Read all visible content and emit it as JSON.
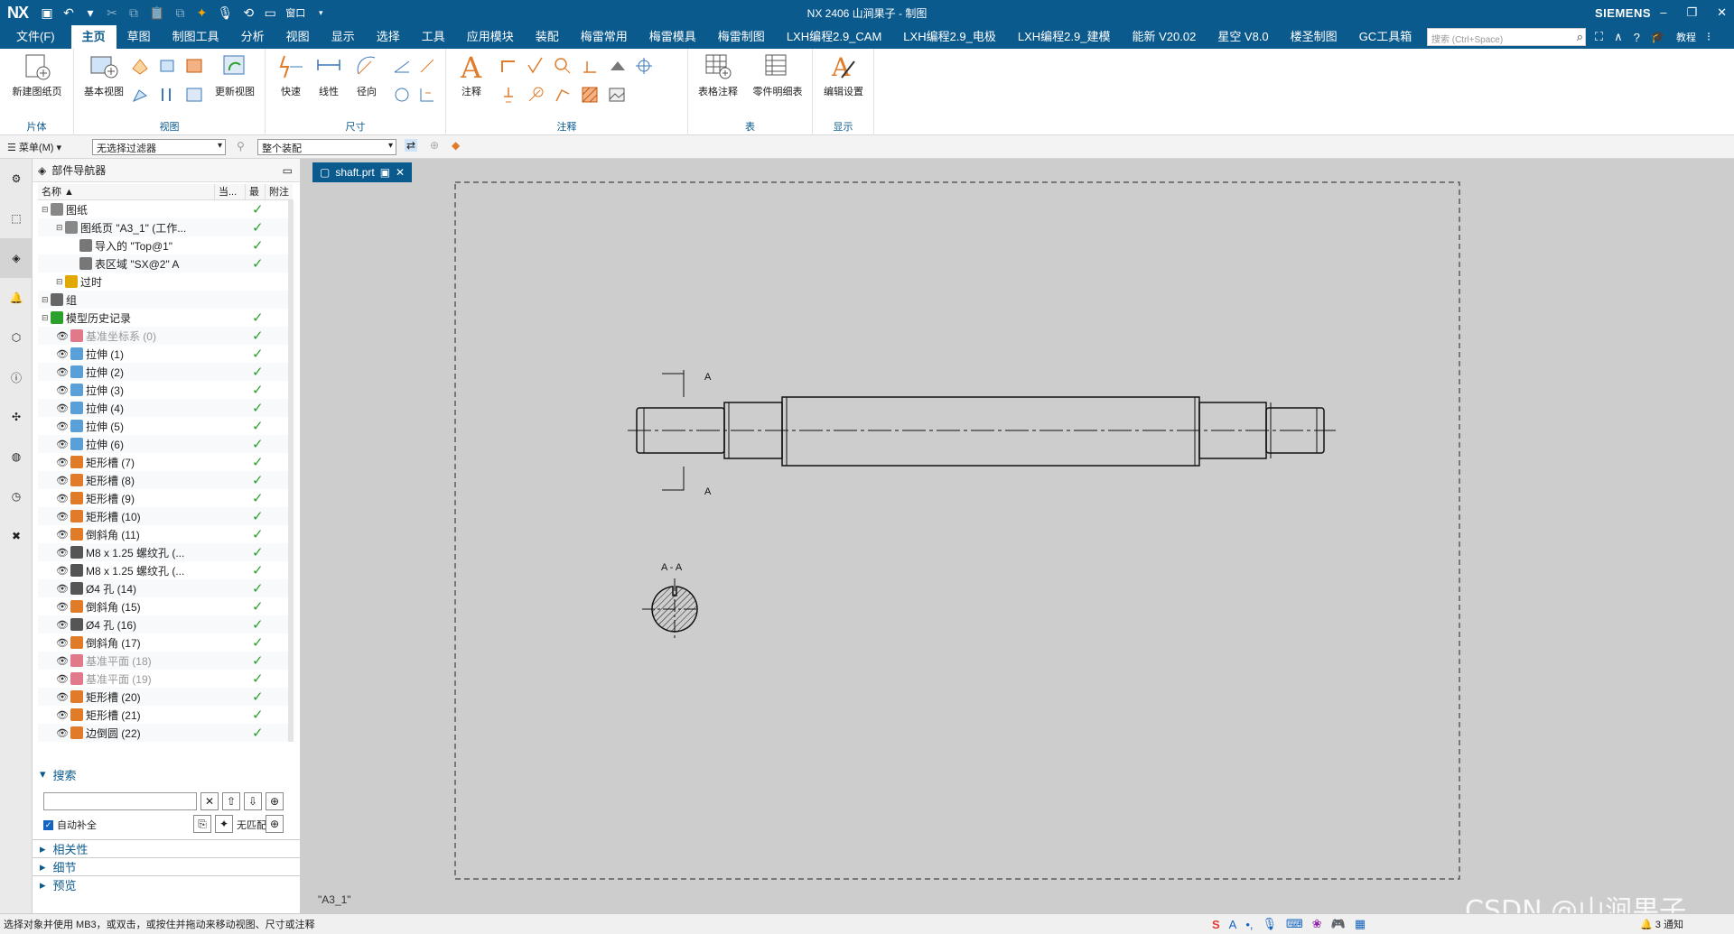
{
  "app": {
    "logo": "NX",
    "window_title": "NX 2406 山涧果子 - 制图",
    "brand": "SIEMENS",
    "window_menu": "窗口",
    "search_placeholder": "搜索 (Ctrl+Space)",
    "tutorial": "教程"
  },
  "menu": {
    "tabs": [
      "文件(F)",
      "主页",
      "草图",
      "制图工具",
      "分析",
      "视图",
      "显示",
      "选择",
      "工具",
      "应用模块",
      "装配",
      "梅雷常用",
      "梅雷模具",
      "梅雷制图",
      "LXH编程2.9_CAM",
      "LXH编程2.9_电极",
      "LXH编程2.9_建模",
      "能新 V20.02",
      "星空 V8.0",
      "楼圣制图",
      "GC工具箱"
    ],
    "active_index": 1
  },
  "ribbon": {
    "groups": [
      {
        "title": "片体",
        "buttons": [
          "新建图纸页"
        ]
      },
      {
        "title": "视图",
        "buttons": [
          "基本视图",
          "更新视图"
        ]
      },
      {
        "title": "尺寸",
        "buttons": [
          "快速",
          "线性",
          "径向"
        ]
      },
      {
        "title": "注释",
        "buttons": [
          "注释"
        ]
      },
      {
        "title": "表",
        "buttons": [
          "表格注释",
          "零件明细表"
        ]
      },
      {
        "title": "显示",
        "buttons": [
          "编辑设置"
        ]
      }
    ]
  },
  "selection_bar": {
    "menu_label": "菜单(M)",
    "filter": "无选择过滤器",
    "scope": "整个装配"
  },
  "navigator": {
    "title": "部件导航器",
    "columns": [
      "名称",
      "当...",
      "最",
      "附注"
    ],
    "rows": [
      {
        "label": "图纸",
        "indent": 0,
        "check": true,
        "dim": false,
        "eye": false,
        "color": "#888888"
      },
      {
        "label": "图纸页 \"A3_1\" (工作...",
        "indent": 1,
        "check": true,
        "dim": false,
        "eye": false,
        "color": "#888888"
      },
      {
        "label": "导入的 \"Top@1\"",
        "indent": 2,
        "check": true,
        "dim": false,
        "eye": false,
        "color": "#777777"
      },
      {
        "label": "表区域 \"SX@2\" A",
        "indent": 2,
        "check": true,
        "dim": false,
        "eye": false,
        "color": "#777777"
      },
      {
        "label": "过时",
        "indent": 1,
        "check": false,
        "dim": false,
        "eye": false,
        "color": "#e0a800"
      },
      {
        "label": "组",
        "indent": 0,
        "check": false,
        "dim": false,
        "eye": false,
        "color": "#666666"
      },
      {
        "label": "模型历史记录",
        "indent": 0,
        "check": true,
        "dim": false,
        "eye": false,
        "color": "#2ca02c"
      },
      {
        "label": "基准坐标系 (0)",
        "indent": 1,
        "check": true,
        "dim": true,
        "eye": true,
        "color": "#e07a8a"
      },
      {
        "label": "拉伸 (1)",
        "indent": 1,
        "check": true,
        "dim": false,
        "eye": true,
        "color": "#5aa0d8"
      },
      {
        "label": "拉伸 (2)",
        "indent": 1,
        "check": true,
        "dim": false,
        "eye": true,
        "color": "#5aa0d8"
      },
      {
        "label": "拉伸 (3)",
        "indent": 1,
        "check": true,
        "dim": false,
        "eye": true,
        "color": "#5aa0d8"
      },
      {
        "label": "拉伸 (4)",
        "indent": 1,
        "check": true,
        "dim": false,
        "eye": true,
        "color": "#5aa0d8"
      },
      {
        "label": "拉伸 (5)",
        "indent": 1,
        "check": true,
        "dim": false,
        "eye": true,
        "color": "#5aa0d8"
      },
      {
        "label": "拉伸 (6)",
        "indent": 1,
        "check": true,
        "dim": false,
        "eye": true,
        "color": "#5aa0d8"
      },
      {
        "label": "矩形槽 (7)",
        "indent": 1,
        "check": true,
        "dim": false,
        "eye": true,
        "color": "#e07b2a"
      },
      {
        "label": "矩形槽 (8)",
        "indent": 1,
        "check": true,
        "dim": false,
        "eye": true,
        "color": "#e07b2a"
      },
      {
        "label": "矩形槽 (9)",
        "indent": 1,
        "check": true,
        "dim": false,
        "eye": true,
        "color": "#e07b2a"
      },
      {
        "label": "矩形槽 (10)",
        "indent": 1,
        "check": true,
        "dim": false,
        "eye": true,
        "color": "#e07b2a"
      },
      {
        "label": "倒斜角 (11)",
        "indent": 1,
        "check": true,
        "dim": false,
        "eye": true,
        "color": "#e07b2a"
      },
      {
        "label": "M8 x 1.25 螺纹孔 (...",
        "indent": 1,
        "check": true,
        "dim": false,
        "eye": true,
        "color": "#555555"
      },
      {
        "label": "M8 x 1.25 螺纹孔 (...",
        "indent": 1,
        "check": true,
        "dim": false,
        "eye": true,
        "color": "#555555"
      },
      {
        "label": "Ø4 孔 (14)",
        "indent": 1,
        "check": true,
        "dim": false,
        "eye": true,
        "color": "#555555"
      },
      {
        "label": "倒斜角 (15)",
        "indent": 1,
        "check": true,
        "dim": false,
        "eye": true,
        "color": "#e07b2a"
      },
      {
        "label": "Ø4 孔 (16)",
        "indent": 1,
        "check": true,
        "dim": false,
        "eye": true,
        "color": "#555555"
      },
      {
        "label": "倒斜角 (17)",
        "indent": 1,
        "check": true,
        "dim": false,
        "eye": true,
        "color": "#e07b2a"
      },
      {
        "label": "基准平面 (18)",
        "indent": 1,
        "check": true,
        "dim": true,
        "eye": true,
        "color": "#e07a8a"
      },
      {
        "label": "基准平面 (19)",
        "indent": 1,
        "check": true,
        "dim": true,
        "eye": true,
        "color": "#e07a8a"
      },
      {
        "label": "矩形槽 (20)",
        "indent": 1,
        "check": true,
        "dim": false,
        "eye": true,
        "color": "#e07b2a"
      },
      {
        "label": "矩形槽 (21)",
        "indent": 1,
        "check": true,
        "dim": false,
        "eye": true,
        "color": "#e07b2a"
      },
      {
        "label": "边倒圆 (22)",
        "indent": 1,
        "check": true,
        "dim": false,
        "eye": true,
        "color": "#e07b2a"
      }
    ]
  },
  "search": {
    "title": "搜索",
    "autocomplete": "自动补全",
    "no_match": "无匹配",
    "sections": [
      "相关性",
      "细节",
      "预览"
    ]
  },
  "document": {
    "tab": "shaft.prt",
    "sheet_label": "\"A3_1\"",
    "section_label_top": "A",
    "section_label_bottom": "A",
    "section_view_label": "A - A"
  },
  "status": {
    "message": "选择对象并使用 MB3，或双击，或按住并拖动来移动视图、尺寸或注释",
    "notifications": "3 通知",
    "watermark": "CSDN @山涧果子"
  }
}
